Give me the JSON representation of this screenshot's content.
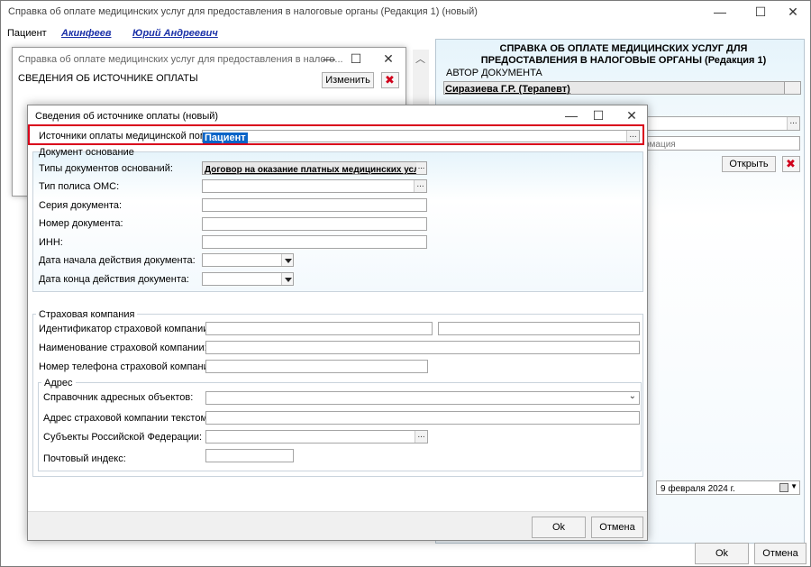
{
  "main_window": {
    "title": "Справка об оплате медицинских услуг для предоставления в налоговые органы (Редакция 1) (новый)",
    "patient_label": "Пациент",
    "patient_surname": "Акинфеев",
    "patient_name": "Юрий Андреевич",
    "ok_label": "Ok",
    "cancel_label": "Отмена"
  },
  "right_panel": {
    "heading": "СПРАВКА ОБ ОПЛАТЕ МЕДИЦИНСКИХ УСЛУГ ДЛЯ ПРЕДОСТАВЛЕНИЯ В НАЛОГОВЫЕ ОРГАНЫ (Редакция 1)",
    "author_label": "АВТОР ДОКУМЕНТА",
    "author_value": "Сиразиева Г.Р. (Терапевт)",
    "info_partial": "рмация",
    "open_label": "Открыть",
    "date_value": "9 февраля  2024 г."
  },
  "mid_window": {
    "title": "Справка об оплате медицинских услуг для предоставления в налого...",
    "section_label": "СВЕДЕНИЯ ОБ ИСТОЧНИКЕ ОПЛАТЫ",
    "edit_label": "Изменить"
  },
  "dialog": {
    "title": "Сведения об источнике оплаты (новый)",
    "source_label": "Источники оплаты медицинской помощи:",
    "source_value": "Пациент",
    "doc_group": "Документ основание",
    "doc_types_label": "Типы документов оснований:",
    "doc_types_value": "Договор на оказание платных медицинских услу",
    "oms_label": "Тип полиса ОМС:",
    "series_label": "Серия документа:",
    "number_label": "Номер документа:",
    "inn_label": "ИНН:",
    "start_label": "Дата начала действия документа:",
    "end_label": "Дата конца действия документа:",
    "ins_group": "Страховая компания",
    "ins_id_label": "Идентификатор страховой компании:",
    "ins_name_label": "Наименование страховой компании:",
    "ins_phone_label": "Номер телефона страховой компании:",
    "addr_group": "Адрес",
    "addr_ref_label": "Справочник адресных объектов:",
    "addr_text_label": "Адрес страховой компании текстом:",
    "subjects_label": "Субъекты Российской Федерации:",
    "postal_label": "Почтовый индекс:",
    "ok_label": "Ok",
    "cancel_label": "Отмена"
  }
}
